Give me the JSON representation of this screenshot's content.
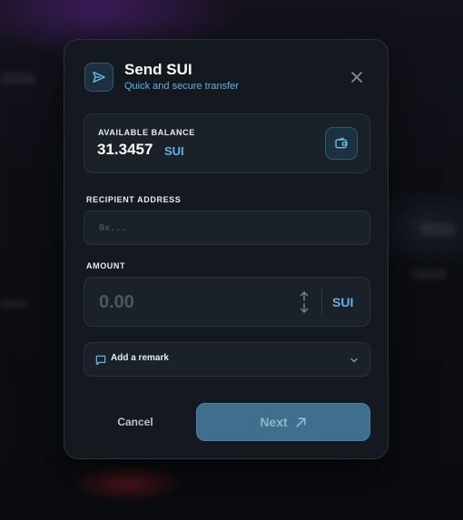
{
  "modal": {
    "title": "Send SUI",
    "subtitle": "Quick and secure transfer",
    "header_icon": "send-icon",
    "close_icon": "close-icon"
  },
  "balance": {
    "label": "AVAILABLE BALANCE",
    "value": "31.3457",
    "unit": "SUI",
    "wallet_icon": "wallet-icon"
  },
  "recipient": {
    "label": "RECIPIENT ADDRESS",
    "placeholder": "0x...",
    "value": ""
  },
  "amount": {
    "label": "AMOUNT",
    "placeholder": "0.00",
    "value": "",
    "unit": "SUI",
    "swap_icon": "swap-vertical-icon"
  },
  "remark": {
    "label": "Add a remark",
    "icon": "message-square-icon",
    "chevron_icon": "chevron-down-icon"
  },
  "actions": {
    "cancel_label": "Cancel",
    "next_label": "Next",
    "next_icon": "arrow-up-right-icon"
  },
  "colors": {
    "accent": "#5fb3e6",
    "panel": "#141920",
    "card": "#1b2129",
    "next_button": "#3f6f8d"
  }
}
